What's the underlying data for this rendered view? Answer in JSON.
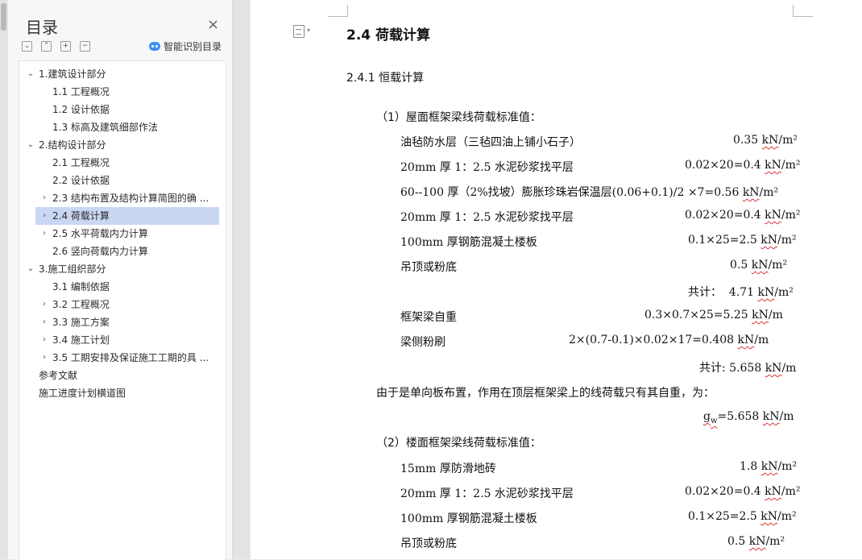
{
  "toc": {
    "title": "目录",
    "close_icon": "×",
    "tools": [
      "⌄",
      "⌃",
      "+",
      "−"
    ],
    "smart_label": "智能识别目录",
    "items": [
      {
        "label": "1.建筑设计部分",
        "level": 1,
        "arrow": "⌄"
      },
      {
        "label": "1.1 工程概况",
        "level": 2,
        "arrow": ""
      },
      {
        "label": "1.2 设计依据",
        "level": 2,
        "arrow": ""
      },
      {
        "label": "1.3 标高及建筑细部作法",
        "level": 2,
        "arrow": ""
      },
      {
        "label": "2.结构设计部分",
        "level": 1,
        "arrow": "⌄"
      },
      {
        "label": "2.1 工程概况",
        "level": 2,
        "arrow": ""
      },
      {
        "label": "2.2 设计依据",
        "level": 2,
        "arrow": ""
      },
      {
        "label": "2.3 结构布置及结构计算简图的确 ...",
        "level": 2,
        "arrow": "›"
      },
      {
        "label": "2.4 荷载计算",
        "level": 2,
        "arrow": "›",
        "active": true
      },
      {
        "label": "2.5 水平荷载内力计算",
        "level": 2,
        "arrow": "›"
      },
      {
        "label": "2.6 竖向荷载内力计算",
        "level": 2,
        "arrow": ""
      },
      {
        "label": "3.施工组织部分",
        "level": 1,
        "arrow": "⌄"
      },
      {
        "label": "3.1 编制依据",
        "level": 2,
        "arrow": ""
      },
      {
        "label": "3.2 工程概况",
        "level": 2,
        "arrow": "›"
      },
      {
        "label": "3.3 施工方案",
        "level": 2,
        "arrow": "›"
      },
      {
        "label": "3.4 施工计划",
        "level": 2,
        "arrow": "›"
      },
      {
        "label": "3.5 工期安排及保证施工工期的具 ...",
        "level": 2,
        "arrow": "›"
      },
      {
        "label": "参考文献",
        "level": 0,
        "arrow": ""
      },
      {
        "label": "施工进度计划横道图",
        "level": 0,
        "arrow": ""
      }
    ]
  },
  "doc": {
    "heading": "2.4 荷载计算",
    "sub1": "2.4.1 恒载计算",
    "roof": {
      "title": "（1）屋面框架梁线荷载标准值：",
      "r1_label": "油毡防水层（三毡四油上铺小石子）",
      "r1_val": "0.35 ",
      "r1_unit": "kN",
      "r1_tail": "/m²",
      "r2_label": "20mm 厚 1：2.5 水泥砂浆找平层",
      "r2_val": "0.02×20=0.4 ",
      "r2_unit": "kN",
      "r2_tail": "/m²",
      "r3_label": "60--100 厚（2%找坡）膨胀珍珠岩保温层(0.06+0.1)/2 ×7=0.56 ",
      "r3_unit": "kN",
      "r3_tail": "/m²",
      "r4_label": "20mm 厚 1：2.5 水泥砂浆找平层",
      "r4_val": "0.02×20=0.4 ",
      "r4_unit": "kN",
      "r4_tail": "/m²",
      "r5_label": "100mm 厚钢筋混凝土楼板",
      "r5_val": "0.1×25=2.5 ",
      "r5_unit": "kN",
      "r5_tail": "/m²",
      "r6_label": "吊顶或粉底",
      "r6_val": "0.5 ",
      "r6_unit": "kN",
      "r6_tail": "/m²",
      "sum1_label": "共计：",
      "sum1_val": "4.71 ",
      "sum1_unit": "kN",
      "sum1_tail": "/m²",
      "r7_label": "框架梁自重",
      "r7_val": "0.3×0.7×25=5.25 ",
      "r7_unit": "kN",
      "r7_tail": "/m",
      "r8_label": "梁侧粉刷",
      "r8_val": "2×(0.7-0.1)×0.02×17=0.408 ",
      "r8_unit": "kN",
      "r8_tail": "/m",
      "sum2_label": "共计: 5.658 ",
      "sum2_unit": "kN",
      "sum2_tail": "/m",
      "note": "由于是单向板布置，作用在顶层框架梁上的线荷载只有其自重，为：",
      "g_sym": "g",
      "g_sub": "w",
      "g_val": "=5.658 ",
      "g_unit": "kN",
      "g_tail": "/m"
    },
    "floor": {
      "title": "（2）楼面框架梁线荷载标准值：",
      "f1_label": "15mm 厚防滑地砖",
      "f1_val": "1.8 ",
      "f1_unit": "kN",
      "f1_tail": "/m²",
      "f2_label": "20mm 厚 1：2.5 水泥砂浆找平层",
      "f2_val": "0.02×20=0.4 ",
      "f2_unit": "kN",
      "f2_tail": "/m²",
      "f3_label": "100mm 厚钢筋混凝土楼板",
      "f3_val": "0.1×25=2.5 ",
      "f3_unit": "kN",
      "f3_tail": "/m²",
      "f4_label": "吊顶或粉底",
      "f4_val": "0.5 ",
      "f4_unit": "kN",
      "f4_tail": "/m²"
    }
  }
}
